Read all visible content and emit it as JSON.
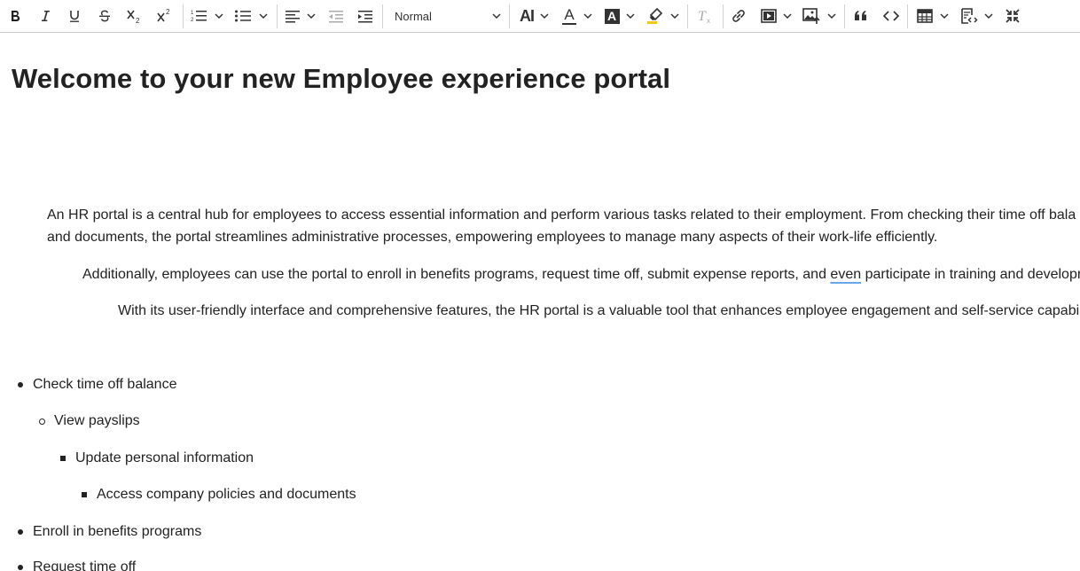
{
  "toolbar": {
    "heading_select_value": "Normal",
    "font_size_label": "AI",
    "font_color_label": "A",
    "bg_color_label": "A",
    "clear_format_label": "T"
  },
  "document": {
    "title": "Welcome to your new Employee experience portal",
    "para1_line1": "An HR portal is a central hub for employees to access essential information and perform various tasks related to their employment. From checking their time off bala",
    "para1_line2": "and documents, the portal streamlines administrative processes, empowering employees to manage many aspects of their work-life efficiently.",
    "para2_pre": "Additionally, employees can use the portal to enroll in benefits programs, request time off, submit expense reports, and ",
    "para2_flagged": "even",
    "para2_post": " participate in training and developr",
    "para3": "With its user-friendly interface and comprehensive features, the HR portal is a valuable tool that enhances employee engagement and self-service capabili",
    "list": [
      "Check time off balance",
      "View payslips",
      "Update personal information",
      "Access company policies and documents",
      "Enroll in benefits programs",
      "Request time off"
    ]
  }
}
